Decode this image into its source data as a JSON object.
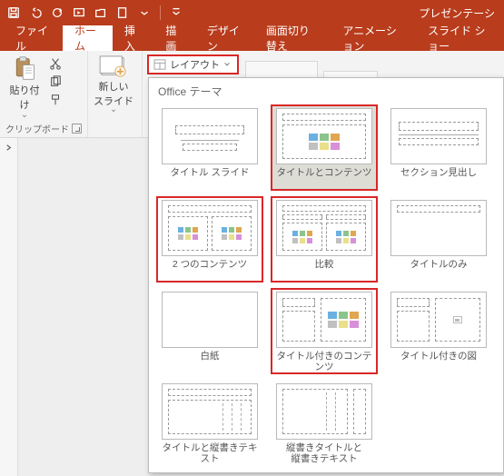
{
  "titlebar": {
    "doc_title": "プレゼンテーシ"
  },
  "tabs": {
    "file": "ファイル",
    "home": "ホーム",
    "insert": "挿入",
    "draw": "描画",
    "design": "デザイン",
    "transitions": "画面切り替え",
    "animations": "アニメーション",
    "slideshow": "スライド ショー"
  },
  "ribbon": {
    "clipboard": {
      "paste": "貼り付け",
      "group_label": "クリップボード"
    },
    "slides": {
      "new_slide": "新しい\nスライド",
      "layout": "レイアウト"
    }
  },
  "gallery": {
    "header": "Office テーマ",
    "layouts": [
      {
        "label": "タイトル スライド",
        "type": "title",
        "highlight": false,
        "selected": false
      },
      {
        "label": "タイトルとコンテンツ",
        "type": "titlecontent",
        "highlight": true,
        "selected": true
      },
      {
        "label": "セクション見出し",
        "type": "section",
        "highlight": false,
        "selected": false
      },
      {
        "label": "2 つのコンテンツ",
        "type": "twocontent",
        "highlight": true,
        "selected": false
      },
      {
        "label": "比較",
        "type": "comparison",
        "highlight": true,
        "selected": false
      },
      {
        "label": "タイトルのみ",
        "type": "titleonly",
        "highlight": false,
        "selected": false
      },
      {
        "label": "白紙",
        "type": "blank",
        "highlight": false,
        "selected": false
      },
      {
        "label": "タイトル付きのコンテンツ",
        "type": "contentcaption",
        "highlight": true,
        "selected": false
      },
      {
        "label": "タイトル付きの図",
        "type": "piccaption",
        "highlight": false,
        "selected": false
      },
      {
        "label": "タイトルと縦書きテキスト",
        "type": "verttext",
        "highlight": false,
        "selected": false
      },
      {
        "label": "縦書きタイトルと\n縦書きテキスト",
        "type": "verttitle",
        "highlight": false,
        "selected": false
      }
    ]
  }
}
